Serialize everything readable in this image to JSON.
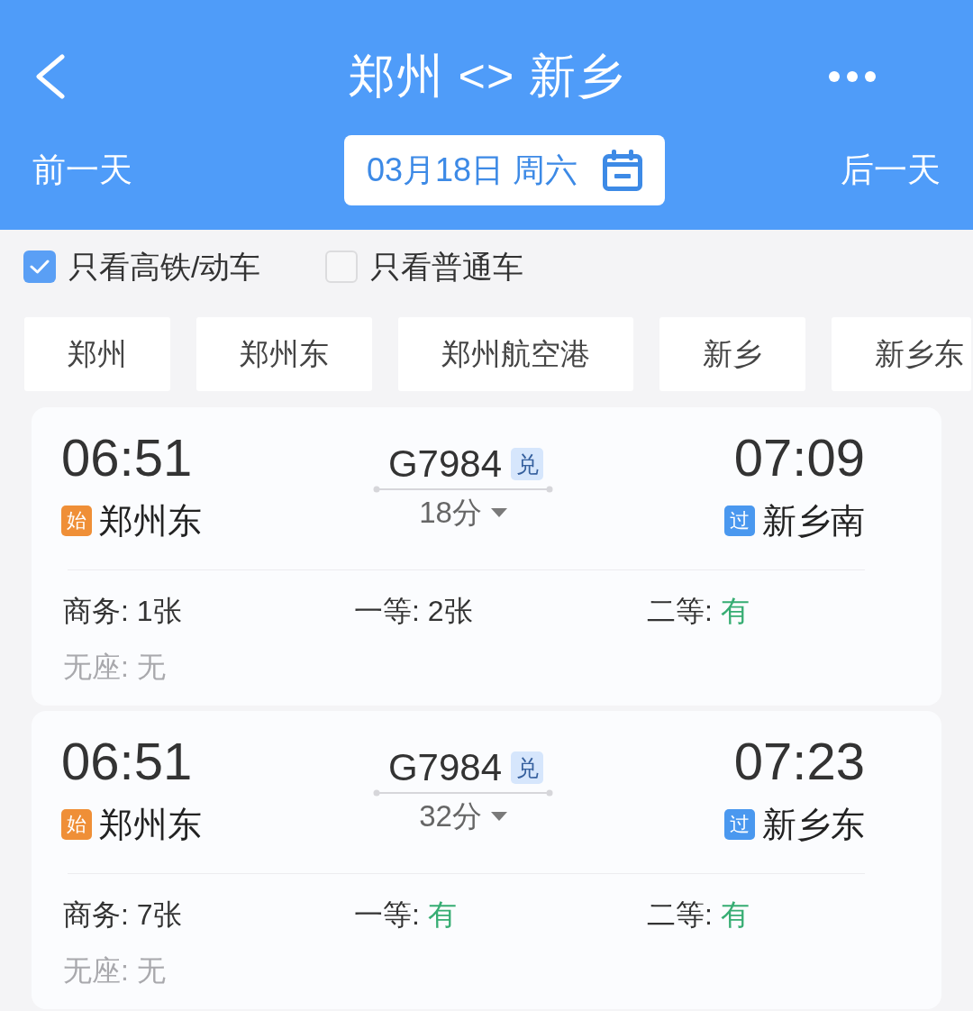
{
  "header": {
    "title": "郑州 <> 新乡",
    "prev_day": "前一天",
    "date": "03月18日 周六",
    "next_day": "后一天"
  },
  "filters": [
    {
      "label": "只看高铁/动车",
      "checked": true
    },
    {
      "label": "只看普通车",
      "checked": false
    }
  ],
  "stations": [
    "郑州",
    "郑州东",
    "郑州航空港",
    "新乡",
    "新乡东"
  ],
  "trains": [
    {
      "departure": {
        "time": "06:51",
        "badge": {
          "text": "始",
          "color": "#ef8f37"
        },
        "station": "郑州东"
      },
      "train_no": "G7984",
      "train_tag": "兑",
      "duration": "18分",
      "arrival": {
        "time": "07:09",
        "badge": {
          "text": "过",
          "color": "#4a98ef"
        },
        "station": "新乡南"
      },
      "seats": [
        {
          "label": "商务:",
          "value": "1张",
          "kind": "count"
        },
        {
          "label": "一等:",
          "value": "2张",
          "kind": "count"
        },
        {
          "label": "二等:",
          "value": "有",
          "kind": "available"
        },
        {
          "label": "无座:",
          "value": "无",
          "kind": "none"
        }
      ]
    },
    {
      "departure": {
        "time": "06:51",
        "badge": {
          "text": "始",
          "color": "#ef8f37"
        },
        "station": "郑州东"
      },
      "train_no": "G7984",
      "train_tag": "兑",
      "duration": "32分",
      "arrival": {
        "time": "07:23",
        "badge": {
          "text": "过",
          "color": "#4a98ef"
        },
        "station": "新乡东"
      },
      "seats": [
        {
          "label": "商务:",
          "value": "7张",
          "kind": "count"
        },
        {
          "label": "一等:",
          "value": "有",
          "kind": "available"
        },
        {
          "label": "二等:",
          "value": "有",
          "kind": "available"
        },
        {
          "label": "无座:",
          "value": "无",
          "kind": "none"
        }
      ]
    }
  ]
}
